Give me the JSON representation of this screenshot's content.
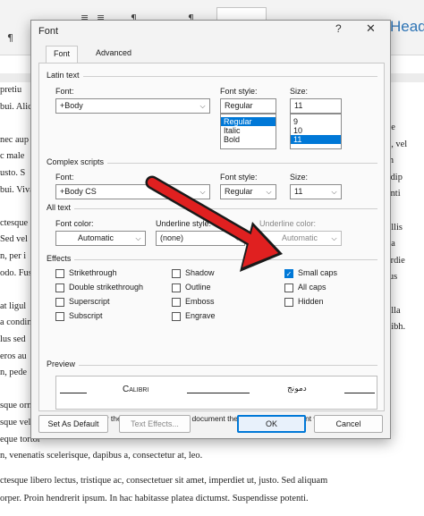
{
  "word": {
    "ribbon_glyphs": [
      "≣",
      "≣",
      "¶",
      "¶",
      "¶"
    ],
    "head_label": "Head",
    "left_lines": [
      "pretiu",
      "bui. Alic",
      "",
      "nec aup",
      "c male",
      "usto. S",
      "bui. Viva",
      "",
      "ctesque",
      "Sed vel",
      "n, per i",
      "odo. Fus",
      "",
      "at ligul",
      "a condim",
      "lus sed",
      "eros au",
      "n, pede",
      "",
      "sque orn",
      "sque velit",
      "eque tortor",
      "n, venenatis scelerisque, dapibus a, consectetur at, leo."
    ],
    "right_lines": [
      "ue",
      "u, vel",
      "m",
      "adip",
      "enti",
      "",
      "ollis",
      "na",
      "erdie",
      "lus",
      "",
      "ulla",
      "nibh.",
      "",
      "",
      "",
      ""
    ],
    "bottom_lines": [
      "ctesque libero lectus, tristique ac, consectetuer sit amet, imperdiet ut, justo. Sed aliquam",
      "orper. Proin hendrerit ipsum. In hac habitasse platea dictumst. Suspendisse potenti."
    ]
  },
  "dialog": {
    "title": "Font",
    "help": "?",
    "close": "✕",
    "tabs": [
      "Font",
      "Advanced"
    ],
    "latin": {
      "group": "Latin text",
      "font_label": "Font:",
      "font_value": "+Body",
      "style_label": "Font style:",
      "style_value": "Regular",
      "style_options": [
        "Regular",
        "Italic",
        "Bold"
      ],
      "style_selected": "Regular",
      "size_label": "Size:",
      "size_value": "11",
      "size_options": [
        "9",
        "10",
        "11"
      ],
      "size_selected": "11"
    },
    "complex": {
      "group": "Complex scripts",
      "font_label": "Font:",
      "font_value": "+Body CS",
      "style_label": "Font style:",
      "style_value": "Regular",
      "size_label": "Size:",
      "size_value": "11"
    },
    "all_text": {
      "group": "All text",
      "color_label": "Font color:",
      "color_value": "Automatic",
      "underline_label": "Underline style:",
      "underline_value": "(none)",
      "ucolor_label": "Underline color:",
      "ucolor_value": "Automatic"
    },
    "effects": {
      "group": "Effects",
      "items": [
        {
          "label": "Strikethrough",
          "checked": false
        },
        {
          "label": "Double strikethrough",
          "checked": false
        },
        {
          "label": "Superscript",
          "checked": false
        },
        {
          "label": "Subscript",
          "checked": false
        },
        {
          "label": "Shadow",
          "checked": false
        },
        {
          "label": "Outline",
          "checked": false
        },
        {
          "label": "Emboss",
          "checked": false
        },
        {
          "label": "Engrave",
          "checked": false
        },
        {
          "label": "Small caps",
          "checked": true
        },
        {
          "label": "All caps",
          "checked": false
        },
        {
          "label": "Hidden",
          "checked": false
        }
      ]
    },
    "preview": {
      "group": "Preview",
      "sample_latin": "Calibri",
      "sample_arabic": "دمونج",
      "note": "This is the body theme font. The current document theme defines which font will be used."
    },
    "buttons": {
      "set_default": "Set As Default",
      "text_effects": "Text Effects...",
      "ok": "OK",
      "cancel": "Cancel"
    },
    "colors": {
      "accent": "#0078d7",
      "arrow": "#e02020"
    }
  }
}
